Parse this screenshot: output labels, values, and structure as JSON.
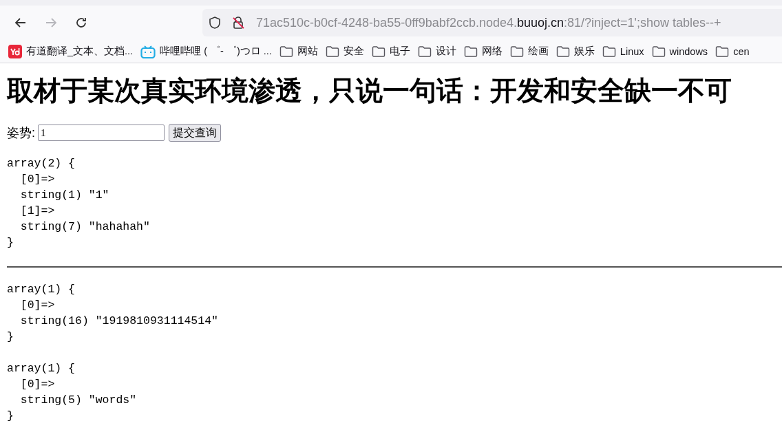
{
  "toolbar": {
    "back": {
      "disabled": false
    },
    "forward": {
      "disabled": true
    },
    "url": {
      "before": "71ac510c-b0cf-4248-ba55-0ff9babf2ccb.node4.",
      "host": "buuoj.cn",
      "after": ":81/?inject=1';show tables--+"
    }
  },
  "bookmarks": [
    {
      "kind": "youdao",
      "label": "有道翻译_文本、文档..."
    },
    {
      "kind": "bilibili",
      "label": "哔哩哔哩 ( ゜- ゜)つロ ..."
    },
    {
      "kind": "folder",
      "label": "网站"
    },
    {
      "kind": "folder",
      "label": "安全"
    },
    {
      "kind": "folder",
      "label": "电子"
    },
    {
      "kind": "folder",
      "label": "设计"
    },
    {
      "kind": "folder",
      "label": "网络"
    },
    {
      "kind": "folder",
      "label": "绘画"
    },
    {
      "kind": "folder",
      "label": "娱乐"
    },
    {
      "kind": "folder",
      "label": "Linux"
    },
    {
      "kind": "folder",
      "label": "windows"
    },
    {
      "kind": "folder",
      "label": "cen"
    }
  ],
  "page": {
    "heading": "取材于某次真实环境渗透，只说一句话：开发和安全缺一不可",
    "form": {
      "label": "姿势:",
      "value": "1",
      "button": "提交查询"
    },
    "sections": [
      {
        "dumps": [
          {
            "header": "array(2) {",
            "items": [
              {
                "key": "[0]=>",
                "value": "string(1) \"1\""
              },
              {
                "key": "[1]=>",
                "value": "string(7) \"hahahah\""
              }
            ],
            "footer": "}"
          }
        ]
      },
      {
        "dumps": [
          {
            "header": "array(1) {",
            "items": [
              {
                "key": "[0]=>",
                "value": "string(16) \"1919810931114514\""
              }
            ],
            "footer": "}"
          },
          {
            "header": "array(1) {",
            "items": [
              {
                "key": "[0]=>",
                "value": "string(5) \"words\""
              }
            ],
            "footer": "}"
          }
        ]
      }
    ]
  }
}
